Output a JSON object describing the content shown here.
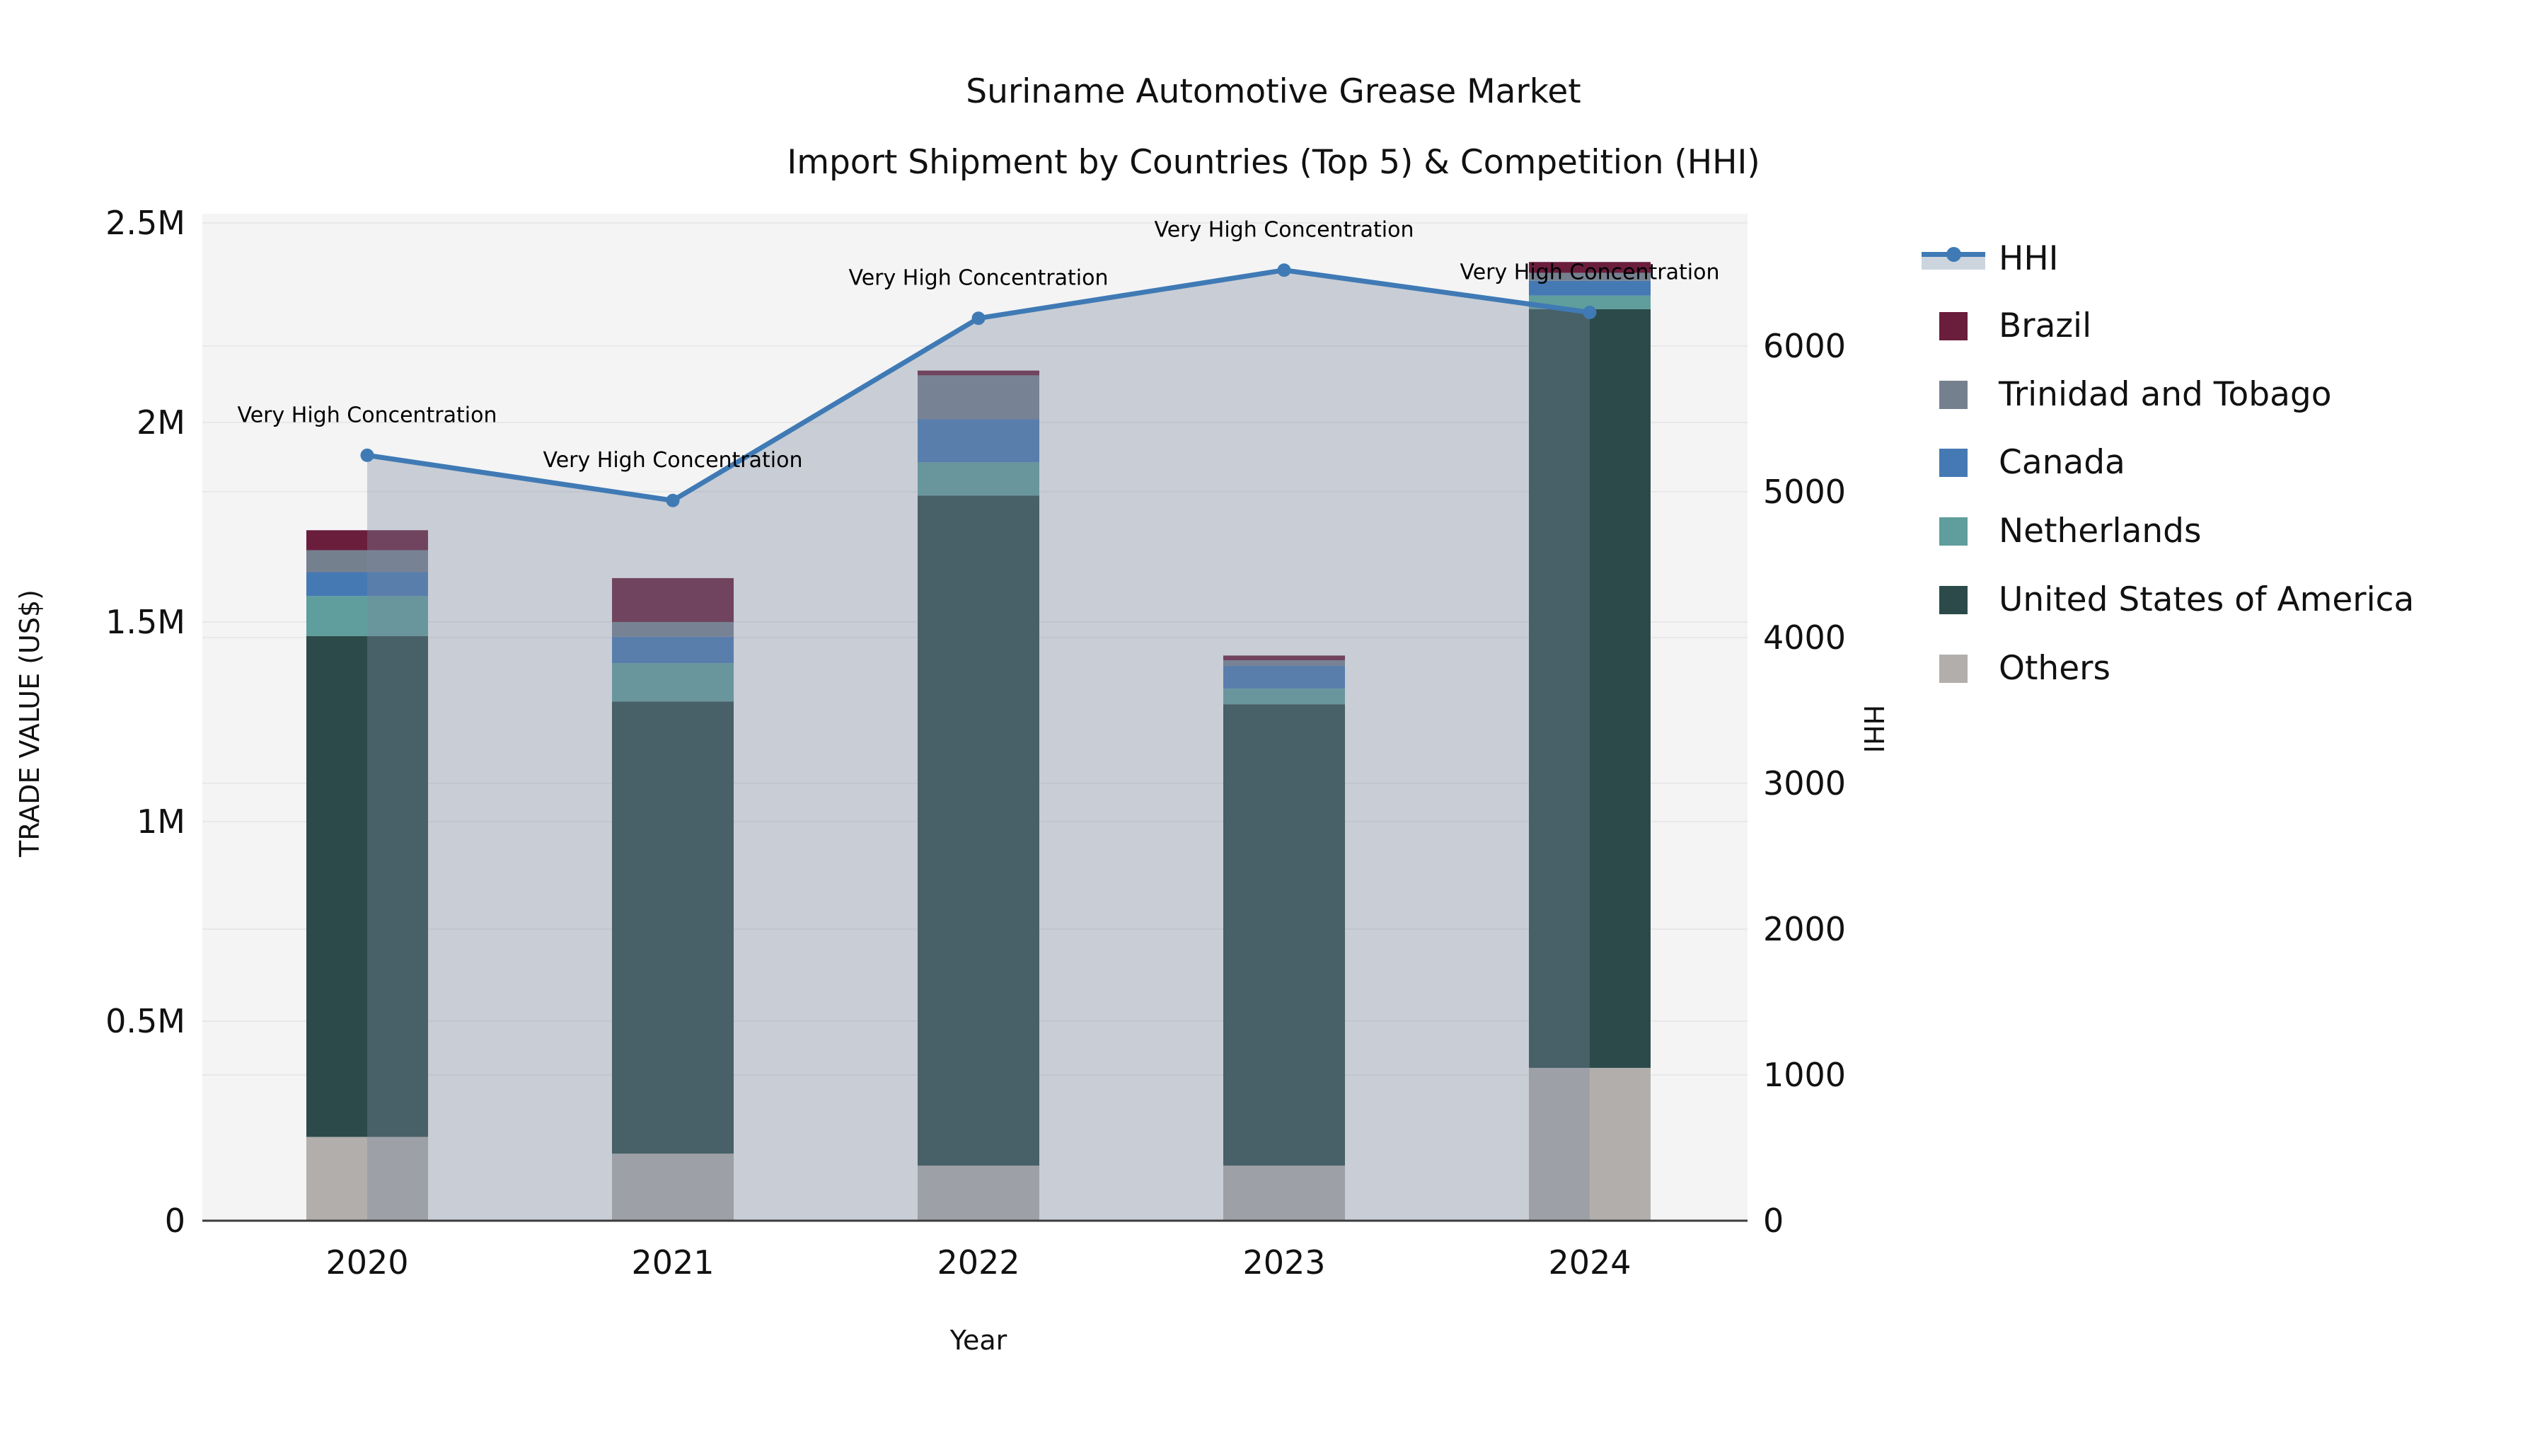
{
  "title": {
    "line1": "Suriname Automotive Grease Market",
    "line2": "Import Shipment by Countries (Top 5) & Competition (HHI)"
  },
  "legend": {
    "items": [
      {
        "label": "HHI",
        "type": "line",
        "color": "#3f7ab5"
      },
      {
        "label": "Brazil",
        "type": "swatch",
        "color": "#6a1e3c"
      },
      {
        "label": "Trinidad and Tobago",
        "type": "swatch",
        "color": "#75808f"
      },
      {
        "label": "Canada",
        "type": "swatch",
        "color": "#4579b4"
      },
      {
        "label": "Netherlands",
        "type": "swatch",
        "color": "#5f9e9c"
      },
      {
        "label": "United States of America",
        "type": "swatch",
        "color": "#2b4a49"
      },
      {
        "label": "Others",
        "type": "swatch",
        "color": "#b1aeac"
      }
    ]
  },
  "colors": {
    "hhi_line": "#3f7ab5",
    "hhi_area_fill": "rgba(124,135,158,0.36)",
    "plot_background": "#f4f4f5",
    "gridline": "#e8e8ea",
    "axis_line": "#3c3c3c",
    "text": "#111111"
  },
  "chart_data": {
    "type": "bar",
    "subtype": "stacked-bars-with-line",
    "categories": [
      "2020",
      "2021",
      "2022",
      "2023",
      "2024"
    ],
    "series": [
      {
        "name": "Brazil",
        "color": "#6a1e3c",
        "values": [
          50000,
          110000,
          12000,
          12000,
          27000
        ]
      },
      {
        "name": "Trinidad and Tobago",
        "color": "#75808f",
        "values": [
          55000,
          37000,
          110000,
          14000,
          20000
        ]
      },
      {
        "name": "Canada",
        "color": "#4579b4",
        "values": [
          60000,
          66000,
          108000,
          57000,
          37000
        ]
      },
      {
        "name": "Netherlands",
        "color": "#5f9e9c",
        "values": [
          100000,
          96000,
          83000,
          39000,
          34000
        ]
      },
      {
        "name": "United States of America",
        "color": "#2b4a49",
        "values": [
          1255000,
          1133000,
          1679000,
          1156000,
          1901000
        ]
      },
      {
        "name": "Others",
        "color": "#b1aeac",
        "values": [
          210000,
          168000,
          138000,
          138000,
          383000
        ]
      }
    ],
    "stack_order_top_to_bottom": [
      "Brazil",
      "Trinidad and Tobago",
      "Canada",
      "Netherlands",
      "United States of America",
      "Others"
    ],
    "line_series": {
      "name": "HHI",
      "color": "#3f7ab5",
      "axis": "right",
      "values": [
        5250,
        4940,
        6190,
        6520,
        6230
      ]
    },
    "annotations": [
      {
        "text": "Very High Concentration",
        "category": "2020"
      },
      {
        "text": "Very High Concentration",
        "category": "2021"
      },
      {
        "text": "Very High Concentration",
        "category": "2022"
      },
      {
        "text": "Very High Concentration",
        "category": "2023"
      },
      {
        "text": "Very High Concentration",
        "category": "2024"
      }
    ],
    "xlabel": "Year",
    "y_left": {
      "label": "TRADE VALUE (US$)",
      "range": [
        0,
        2523000
      ],
      "ticks": [
        {
          "label": "0",
          "value": 0
        },
        {
          "label": "0.5M",
          "value": 500000
        },
        {
          "label": "1M",
          "value": 1000000
        },
        {
          "label": "1.5M",
          "value": 1500000
        },
        {
          "label": "2M",
          "value": 2000000
        },
        {
          "label": "2.5M",
          "value": 2500000
        }
      ]
    },
    "y_right": {
      "label": "HHI",
      "range": [
        0,
        6907
      ],
      "ticks": [
        {
          "label": "0",
          "value": 0
        },
        {
          "label": "1000",
          "value": 1000
        },
        {
          "label": "2000",
          "value": 2000
        },
        {
          "label": "3000",
          "value": 3000
        },
        {
          "label": "4000",
          "value": 4000
        },
        {
          "label": "5000",
          "value": 5000
        },
        {
          "label": "6000",
          "value": 6000
        }
      ]
    },
    "grid": true,
    "legend_position": "right"
  }
}
